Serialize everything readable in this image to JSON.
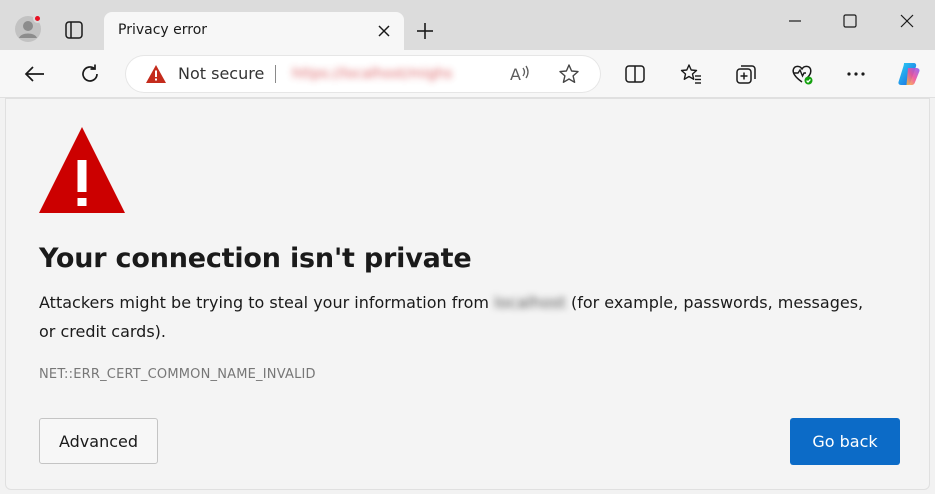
{
  "tab": {
    "title": "Privacy error"
  },
  "address_bar": {
    "security_label": "Not secure",
    "url": "https://localhost/mighs"
  },
  "icons": {
    "profile": "profile-avatar-icon",
    "tab_actions": "tab-actions-icon",
    "close_tab": "close-icon",
    "new_tab": "plus-icon",
    "minimize": "minimize-icon",
    "maximize": "maximize-icon",
    "close_window": "close-icon",
    "back": "arrow-left-icon",
    "refresh": "refresh-icon",
    "not_secure": "warning-triangle-icon",
    "read_aloud": "read-aloud-icon",
    "favorite": "star-icon",
    "split_screen": "split-screen-icon",
    "favorites": "favorites-list-icon",
    "collections": "collections-icon",
    "browser_essentials": "heart-pulse-icon",
    "more": "more-dots-icon",
    "copilot": "copilot-icon"
  },
  "read_aloud_glyph": "Aᵃ",
  "page": {
    "heading": "Your connection isn't private",
    "description_before": "Attackers might be trying to steal your information from ",
    "host": "localhost",
    "description_after": " (for example, passwords, messages, or credit cards).",
    "error_code": "NET::ERR_CERT_COMMON_NAME_INVALID",
    "advanced_label": "Advanced",
    "go_back_label": "Go back"
  },
  "colors": {
    "accent": "#0c6bc7",
    "warning_red": "#cc0000",
    "not_secure_red": "#c42b1c"
  }
}
